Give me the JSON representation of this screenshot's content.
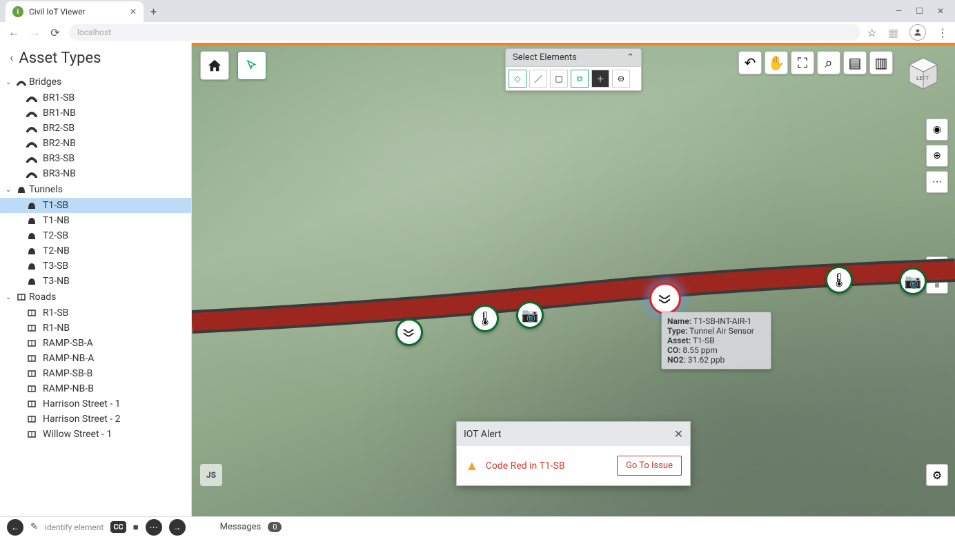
{
  "browser": {
    "tab_title": "Civil IoT Viewer",
    "url_placeholder": "localhost"
  },
  "sidebar": {
    "title": "Asset Types",
    "groups": [
      {
        "label": "Bridges",
        "expanded": true,
        "items": [
          "BR1-SB",
          "BR1-NB",
          "BR2-SB",
          "BR2-NB",
          "BR3-SB",
          "BR3-NB"
        ]
      },
      {
        "label": "Tunnels",
        "expanded": true,
        "selected": "T1-SB",
        "items": [
          "T1-SB",
          "T1-NB",
          "T2-SB",
          "T2-NB",
          "T3-SB",
          "T3-NB"
        ]
      },
      {
        "label": "Roads",
        "expanded": true,
        "items": [
          "R1-SB",
          "R1-NB",
          "RAMP-SB-A",
          "RAMP-NB-A",
          "RAMP-SB-B",
          "RAMP-NB-B",
          "Harrison Street - 1",
          "Harrison Street - 2",
          "Willow Street - 1"
        ]
      }
    ]
  },
  "select_panel": {
    "title": "Select Elements"
  },
  "viewcube": {
    "face": "LEFT"
  },
  "tooltip": {
    "name_label": "Name:",
    "name": "T1-SB-INT-AIR-1",
    "type_label": "Type:",
    "type": "Tunnel Air Sensor",
    "asset_label": "Asset:",
    "asset": "T1-SB",
    "co_label": "CO:",
    "co": "8.55 ppm",
    "no2_label": "NO2:",
    "no2": "31.62 ppb"
  },
  "alert": {
    "title": "IOT Alert",
    "message": "Code Red in T1-SB",
    "button": "Go To Issue"
  },
  "status": {
    "hint": "identify element",
    "messages_label": "Messages",
    "messages_count": "0"
  }
}
